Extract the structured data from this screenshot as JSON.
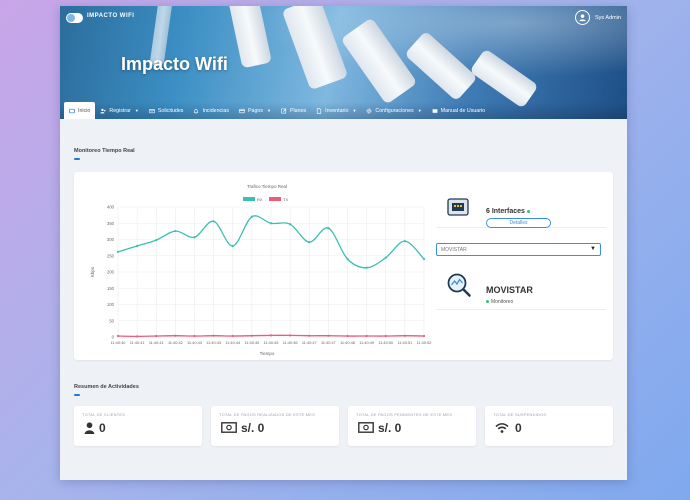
{
  "app": {
    "logo_text": "IMPACTO WIFI",
    "hero_title": "Impacto Wifi",
    "user_name": "Sys Admin"
  },
  "nav": {
    "items": [
      {
        "label": "Inicio",
        "icon": "home-icon",
        "active": true,
        "dropdown": false
      },
      {
        "label": "Registrar",
        "icon": "user-add-icon",
        "dropdown": true
      },
      {
        "label": "Solicitudes",
        "icon": "mail-icon",
        "dropdown": false
      },
      {
        "label": "Incidencias",
        "icon": "bell-icon",
        "dropdown": false
      },
      {
        "label": "Pagos",
        "icon": "card-icon",
        "dropdown": true
      },
      {
        "label": "Planes",
        "icon": "edit-icon",
        "dropdown": false
      },
      {
        "label": "Inventario",
        "icon": "file-icon",
        "dropdown": true
      },
      {
        "label": "Configuraciones",
        "icon": "gear-icon",
        "dropdown": true
      },
      {
        "label": "Manual de Usuario",
        "icon": "book-icon",
        "dropdown": false
      }
    ]
  },
  "monitor": {
    "section_title": "Monitoreo Tiempo Real",
    "interfaces_label": "6 Interfaces",
    "details_button": "Detalles",
    "select_value": "MOVISTAR",
    "isp_name": "MOVISTAR",
    "isp_status": "Monitoreo"
  },
  "chart_data": {
    "type": "line",
    "title": "Trafico Tiempo Real",
    "xlabel": "Tiempo",
    "ylabel": "Kbps",
    "ylim": [
      0,
      400
    ],
    "yticks": [
      0,
      50,
      100,
      150,
      200,
      250,
      300,
      350,
      400
    ],
    "x_tick_labels": [
      "11:40:40",
      "11:40:41",
      "11:40:41",
      "11:40:42",
      "11:40:43",
      "11:40:43",
      "11:40:44",
      "11:40:45",
      "11:40:45",
      "11:40:46",
      "11:40:47",
      "11:40:47",
      "11:40:48",
      "11:40:49",
      "11:40:50",
      "11:40:51",
      "11:40:52"
    ],
    "grid": true,
    "legend_position": "top-center",
    "series": [
      {
        "name": "RX",
        "color": "#3bbfb3",
        "values": [
          262,
          280,
          298,
          326,
          307,
          356,
          280,
          370,
          350,
          347,
          292,
          335,
          240,
          213,
          244,
          295,
          240
        ]
      },
      {
        "name": "TX",
        "color": "#ef5b79",
        "values": [
          3,
          2,
          3,
          4,
          3,
          4,
          3,
          4,
          5,
          5,
          4,
          4,
          3,
          3,
          3,
          4,
          3
        ]
      }
    ]
  },
  "activities": {
    "section_title": "Resumen de Actividades",
    "cards": [
      {
        "label": "TOTAL DE CLIENTES",
        "value": "0",
        "icon": "user-icon"
      },
      {
        "label": "TOTAL DE PAGOS REALIZADOS DE ESTE MES",
        "value": "s/. 0",
        "icon": "money-icon"
      },
      {
        "label": "TOTAL DE PAGOS PENDIENTES DE ESTE MES",
        "value": "s/. 0",
        "icon": "money-icon"
      },
      {
        "label": "TOTAL DE SUSPENDIDOS",
        "value": "0",
        "icon": "wifi-icon"
      }
    ]
  }
}
